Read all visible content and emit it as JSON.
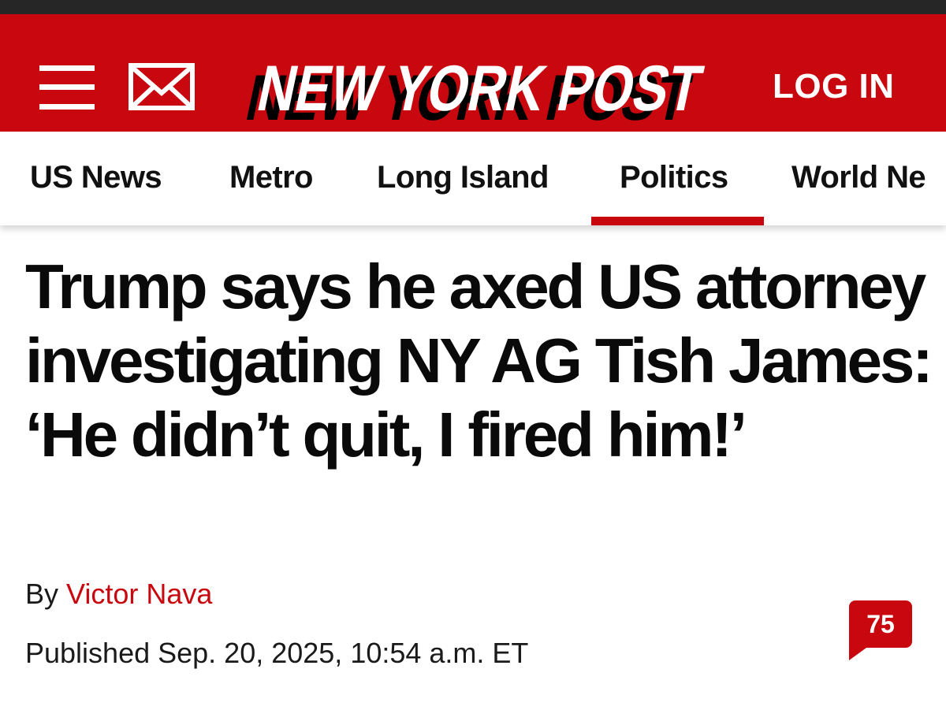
{
  "masthead": {
    "logo_text": "NEW YORK POST",
    "login_label": "LOG IN",
    "menu_icon": "hamburger-menu-icon",
    "mail_icon": "envelope-icon",
    "brand_color": "#c8070e"
  },
  "nav": {
    "items": [
      {
        "label": "US News"
      },
      {
        "label": "Metro"
      },
      {
        "label": "Long Island"
      },
      {
        "label": "Politics",
        "active": true
      },
      {
        "label": "World Ne"
      }
    ]
  },
  "article": {
    "headline": "Trump says he axed US attorney investigating NY AG Tish James: ‘He didn’t quit, I fired him!’",
    "byline_prefix": "By",
    "author": "Victor Nava",
    "published": "Published Sep. 20, 2025, 10:54 a.m. ET",
    "comment_count": "75"
  }
}
